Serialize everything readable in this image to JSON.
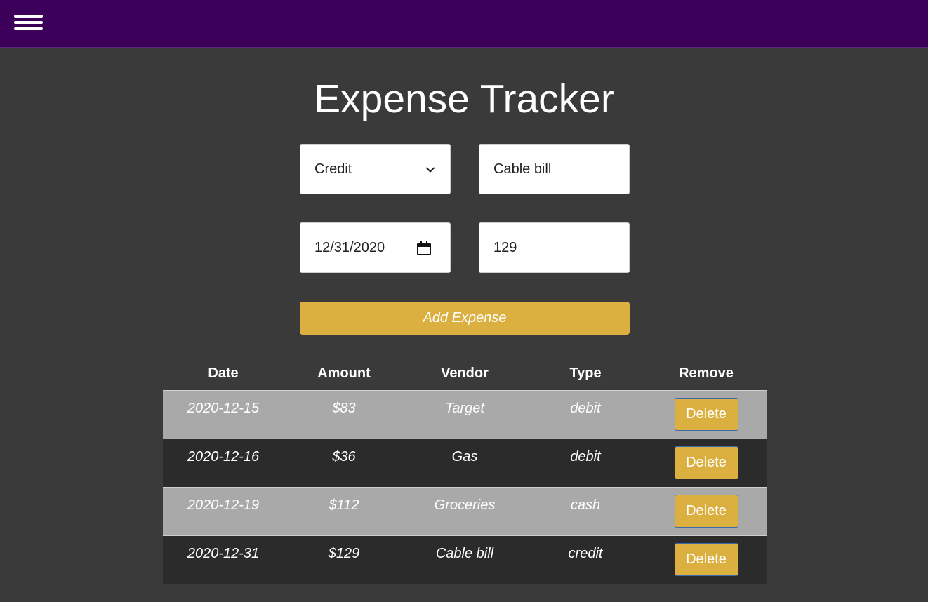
{
  "header": {
    "menu_icon": "hamburger-menu-icon",
    "background": "#3c005a"
  },
  "page": {
    "title": "Expense Tracker"
  },
  "form": {
    "type_select": {
      "value": "Credit",
      "icon": "chevron-down-icon"
    },
    "vendor_input": {
      "value": "Cable bill"
    },
    "date_input": {
      "value": "12/31/2020",
      "icon": "calendar-icon"
    },
    "amount_input": {
      "value": "129"
    },
    "add_button_label": "Add Expense",
    "accent_color": "#dbb040"
  },
  "table": {
    "headers": [
      "Date",
      "Amount",
      "Vendor",
      "Type",
      "Remove"
    ],
    "rows": [
      {
        "date": "2020-12-15",
        "amount": "$83",
        "vendor": "Target",
        "type": "debit",
        "action": "Delete"
      },
      {
        "date": "2020-12-16",
        "amount": "$36",
        "vendor": "Gas",
        "type": "debit",
        "action": "Delete"
      },
      {
        "date": "2020-12-19",
        "amount": "$112",
        "vendor": "Groceries",
        "type": "cash",
        "action": "Delete"
      },
      {
        "date": "2020-12-31",
        "amount": "$129",
        "vendor": "Cable bill",
        "type": "credit",
        "action": "Delete"
      }
    ],
    "row_colors": [
      "#a9a9a9",
      "#2b2b2b"
    ]
  }
}
